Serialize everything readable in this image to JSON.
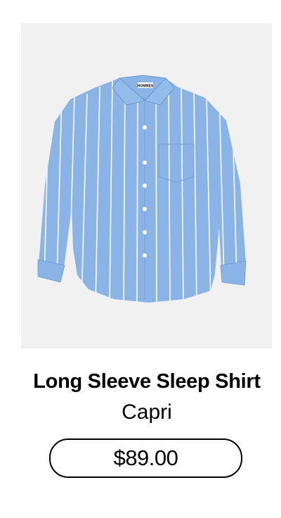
{
  "product": {
    "title": "Long Sleeve Sleep Shirt",
    "color_name": "Capri",
    "price": "$89.00",
    "image": {
      "subject": "shirt-photo",
      "collar_label": "HOMMES"
    }
  },
  "colors": {
    "shirt": "#8ab3e6",
    "stripe": "#ffffff",
    "image_background": "#f1f1f1",
    "text": "#000000",
    "button_border": "#000000"
  }
}
